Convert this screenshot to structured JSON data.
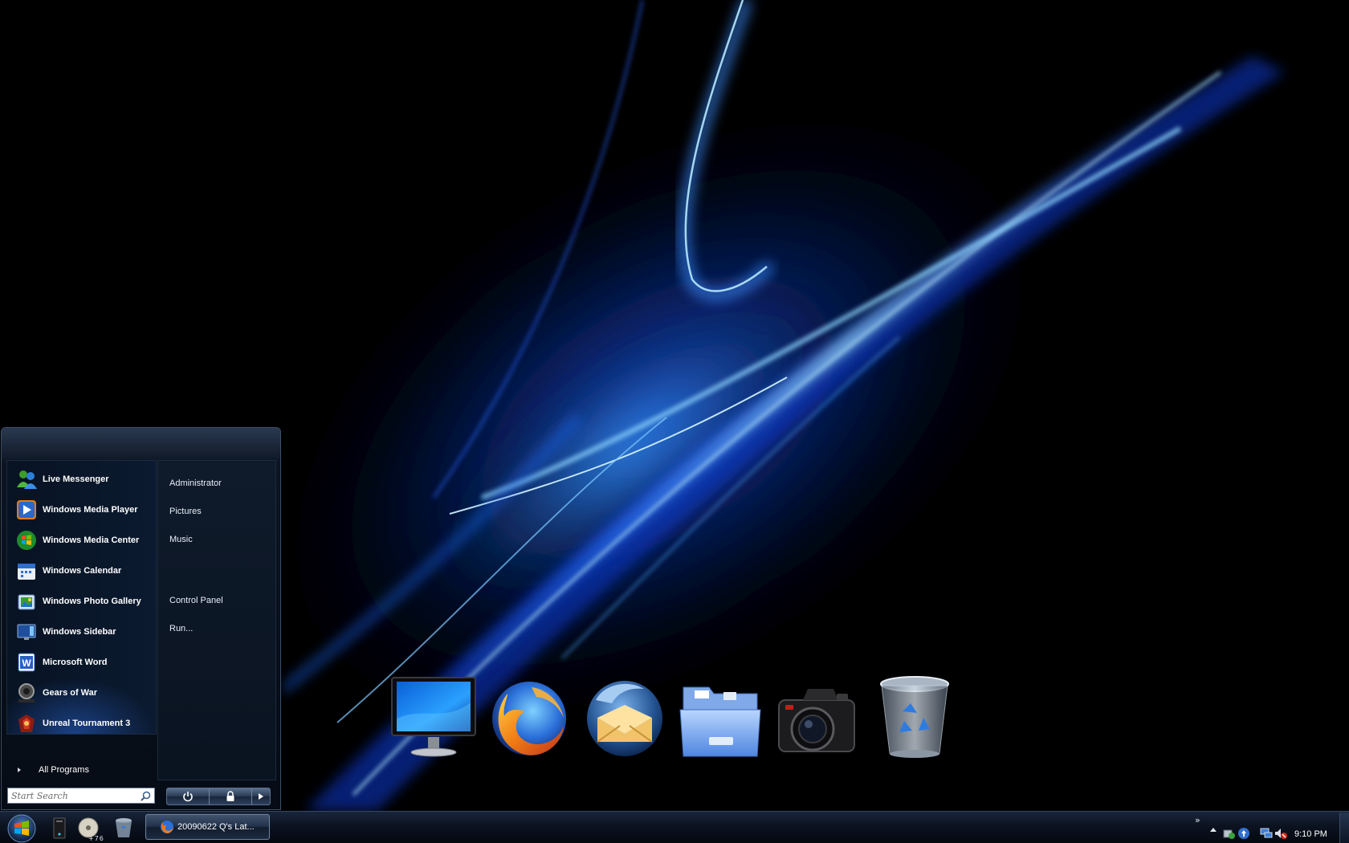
{
  "start_menu": {
    "programs": [
      {
        "label": "Live Messenger",
        "icon": "messenger-icon"
      },
      {
        "label": "Windows Media Player",
        "icon": "media-player-icon"
      },
      {
        "label": "Windows Media Center",
        "icon": "media-center-icon"
      },
      {
        "label": "Windows Calendar",
        "icon": "calendar-icon"
      },
      {
        "label": "Windows Photo Gallery",
        "icon": "photo-gallery-icon"
      },
      {
        "label": "Windows Sidebar",
        "icon": "sidebar-icon"
      },
      {
        "label": "Microsoft Word",
        "icon": "word-icon"
      },
      {
        "label": "Gears of War",
        "icon": "gears-of-war-icon"
      },
      {
        "label": "Unreal Tournament 3",
        "icon": "unreal-tournament-icon"
      }
    ],
    "places": [
      {
        "label": "Administrator"
      },
      {
        "label": "Pictures"
      },
      {
        "label": "Music"
      },
      {
        "label": "Control Panel"
      },
      {
        "label": "Run..."
      }
    ],
    "all_programs_label": "All Programs",
    "search": {
      "placeholder": "Start Search",
      "value": ""
    }
  },
  "dock": {
    "items": [
      {
        "name": "monitor-icon"
      },
      {
        "name": "firefox-icon"
      },
      {
        "name": "thunderbird-icon"
      },
      {
        "name": "folder-icon"
      },
      {
        "name": "camera-icon"
      },
      {
        "name": "recycle-bin-icon"
      }
    ]
  },
  "taskbar": {
    "quick_launch_overflow": "+76",
    "window_button_label": "20090622 Q's Lat...",
    "clock": "9:10 PM",
    "tray_chevron": "»"
  },
  "colors": {
    "accent_blue": "#1e6cff",
    "taskbar_dark": "#0b1320",
    "menu_dark": "#0a1320"
  }
}
